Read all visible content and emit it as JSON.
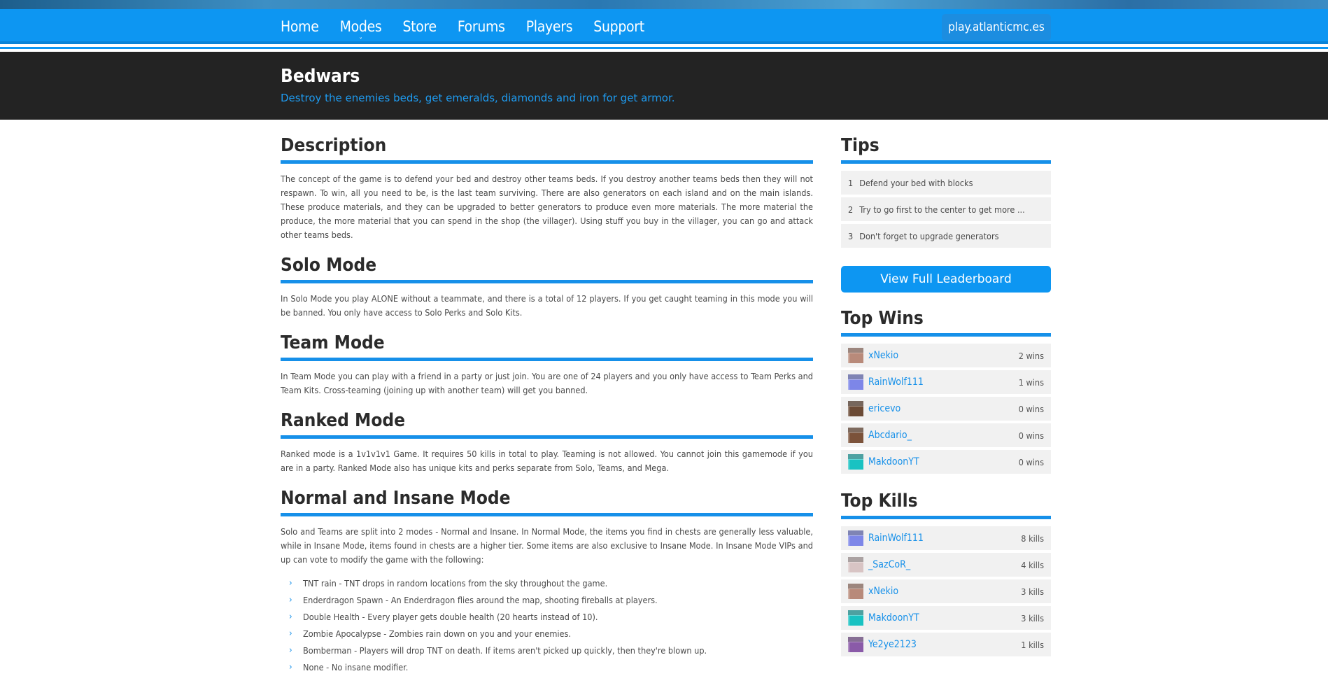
{
  "nav": {
    "items": [
      {
        "label": "Home"
      },
      {
        "label": "Modes",
        "caret": "˅"
      },
      {
        "label": "Store"
      },
      {
        "label": "Forums"
      },
      {
        "label": "Players"
      },
      {
        "label": "Support"
      }
    ],
    "server": "play.atlanticmc.es"
  },
  "hero": {
    "title": "Bedwars",
    "subtitle": "Destroy the enemies beds, get emeralds, diamonds and iron for get armor."
  },
  "sections": [
    {
      "title": "Description",
      "text": "The concept of the game is to defend your bed and destroy other teams beds. If you destroy another teams beds then they will not respawn. To win, all you need to be, is the last team surviving. There are also generators on each island and on the main islands. These produce materials, and they can be upgraded to better generators to produce even more materials. The more material the produce, the more material that you can spend in the shop (the villager). Using stuff you buy in the villager, you can go and attack other teams beds."
    },
    {
      "title": "Solo Mode",
      "text": "In Solo Mode you play ALONE without a teammate, and there is a total of 12 players. If you get caught teaming in this mode you will be banned. You only have access to Solo Perks and Solo Kits."
    },
    {
      "title": "Team Mode",
      "text": "In Team Mode you can play with a friend in a party or just join. You are one of 24 players and you only have access to Team Perks and Team Kits. Cross-teaming (joining up with another team) will get you banned."
    },
    {
      "title": "Ranked Mode",
      "text": "Ranked mode is a 1v1v1v1 Game. It requires 50 kills in total to play. Teaming is not allowed. You cannot join this gamemode if you are in a party. Ranked Mode also has unique kits and perks separate from Solo, Teams, and Mega."
    },
    {
      "title": "Normal and Insane Mode",
      "text": "Solo and Teams are split into 2 modes - Normal and Insane. In Normal Mode, the items you find in chests are generally less valuable, while in Insane Mode, items found in chests are a higher tier. Some items are also exclusive to Insane Mode. In Insane Mode VIPs and up can vote to modify the game with the following:"
    }
  ],
  "modifiers": [
    "TNT rain - TNT drops in random locations from the sky throughout the game.",
    "Enderdragon Spawn - An Enderdragon flies around the map, shooting fireballs at players.",
    "Double Health - Every player gets double health (20 hearts instead of 10).",
    "Zombie Apocalypse - Zombies rain down on you and your enemies.",
    "Bomberman - Players will drop TNT on death. If items aren't picked up quickly, then they're blown up.",
    "None - No insane modifier."
  ],
  "tips": {
    "title": "Tips",
    "items": [
      {
        "num": "1",
        "text": "Defend your bed with blocks"
      },
      {
        "num": "2",
        "text": "Try to go first to the center to get more ..."
      },
      {
        "num": "3",
        "text": "Don't forget to upgrade generators"
      }
    ]
  },
  "leaderboard_button": "View Full Leaderboard",
  "top_wins": {
    "title": "Top Wins",
    "rows": [
      {
        "name": "xNekio",
        "stat": "2 wins",
        "skin": "#b88a7a"
      },
      {
        "name": "RainWolf111",
        "stat": "1 wins",
        "skin": "#7d86e8"
      },
      {
        "name": "ericevo",
        "stat": "0 wins",
        "skin": "#6b4a35"
      },
      {
        "name": "Abcdario_",
        "stat": "0 wins",
        "skin": "#7b523a"
      },
      {
        "name": "MakdoonYT",
        "stat": "0 wins",
        "skin": "#19c2c2"
      }
    ]
  },
  "top_kills": {
    "title": "Top Kills",
    "rows": [
      {
        "name": "RainWolf111",
        "stat": "8 kills",
        "skin": "#7d86e8"
      },
      {
        "name": "_SazCoR_",
        "stat": "4 kills",
        "skin": "#d8c4c4"
      },
      {
        "name": "xNekio",
        "stat": "3 kills",
        "skin": "#b88a7a"
      },
      {
        "name": "MakdoonYT",
        "stat": "3 kills",
        "skin": "#19c2c2"
      },
      {
        "name": "Ye2ye2123",
        "stat": "1 kills",
        "skin": "#8a5aa8"
      }
    ]
  }
}
